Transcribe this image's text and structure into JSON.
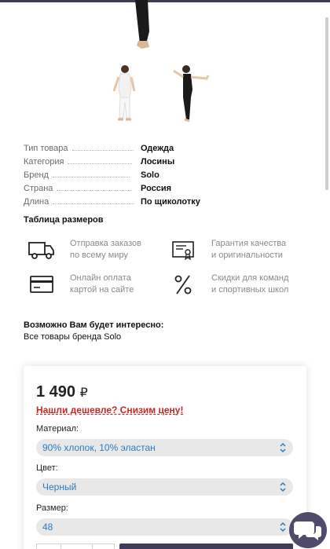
{
  "attributes": [
    {
      "label": "Тип товара",
      "value": "Одежда"
    },
    {
      "label": "Категория",
      "value": "Лосины"
    },
    {
      "label": "Бренд",
      "value": "Solo"
    },
    {
      "label": "Страна",
      "value": "Россия"
    },
    {
      "label": "Длина",
      "value": "По щиколотку"
    }
  ],
  "size_table_label": "Таблица размеров",
  "features": [
    {
      "icon": "truck-icon",
      "line1": "Отправка заказов",
      "line2": "по всему миру"
    },
    {
      "icon": "certificate-icon",
      "line1": "Гарантия качества",
      "line2": "и оригинальности"
    },
    {
      "icon": "credit-card-icon",
      "line1": "Онлайн оплата",
      "line2": "картой на сайте"
    },
    {
      "icon": "percent-icon",
      "line1": "Скидки для команд",
      "line2": "и спортивных школ"
    }
  ],
  "interest": {
    "title": "Возможно Вам будет интересно:",
    "link": "Все товары бренда Solo"
  },
  "purchase": {
    "price": "1 490",
    "currency": "₽",
    "cheaper_link": "Нашли дешевле? Снизим цену!",
    "material_label": "Материал:",
    "material_value": "90% хлопок, 10% эластан",
    "color_label": "Цвет:",
    "color_value": "Черный",
    "size_label": "Размер:",
    "size_value": "48"
  },
  "colors": {
    "accent": "#3f3d56",
    "select_text": "#2a7bbf",
    "cheaper": "#c62828",
    "select_bg": "#e8e8e8"
  }
}
